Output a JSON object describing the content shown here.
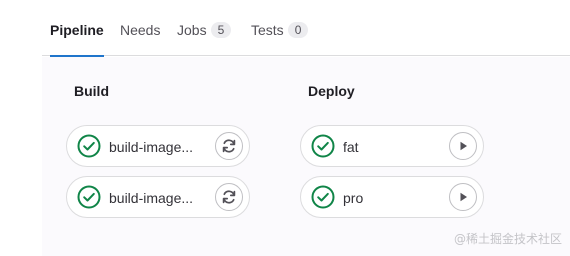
{
  "tabs": [
    {
      "label": "Pipeline",
      "active": true
    },
    {
      "label": "Needs"
    },
    {
      "label": "Jobs",
      "count": "5"
    },
    {
      "label": "Tests",
      "count": "0"
    }
  ],
  "stages": [
    {
      "name": "Build",
      "jobs": [
        {
          "name": "build-image...",
          "status": "passed",
          "action": "retry-icon"
        },
        {
          "name": "build-image...",
          "status": "passed",
          "action": "retry-icon"
        }
      ]
    },
    {
      "name": "Deploy",
      "jobs": [
        {
          "name": "fat",
          "status": "passed",
          "action": "play-icon"
        },
        {
          "name": "pro",
          "status": "passed",
          "action": "play-icon"
        }
      ]
    }
  ],
  "colors": {
    "accent": "#1f75cb",
    "success": "#108548"
  },
  "watermark": "@稀土掘金技术社区"
}
